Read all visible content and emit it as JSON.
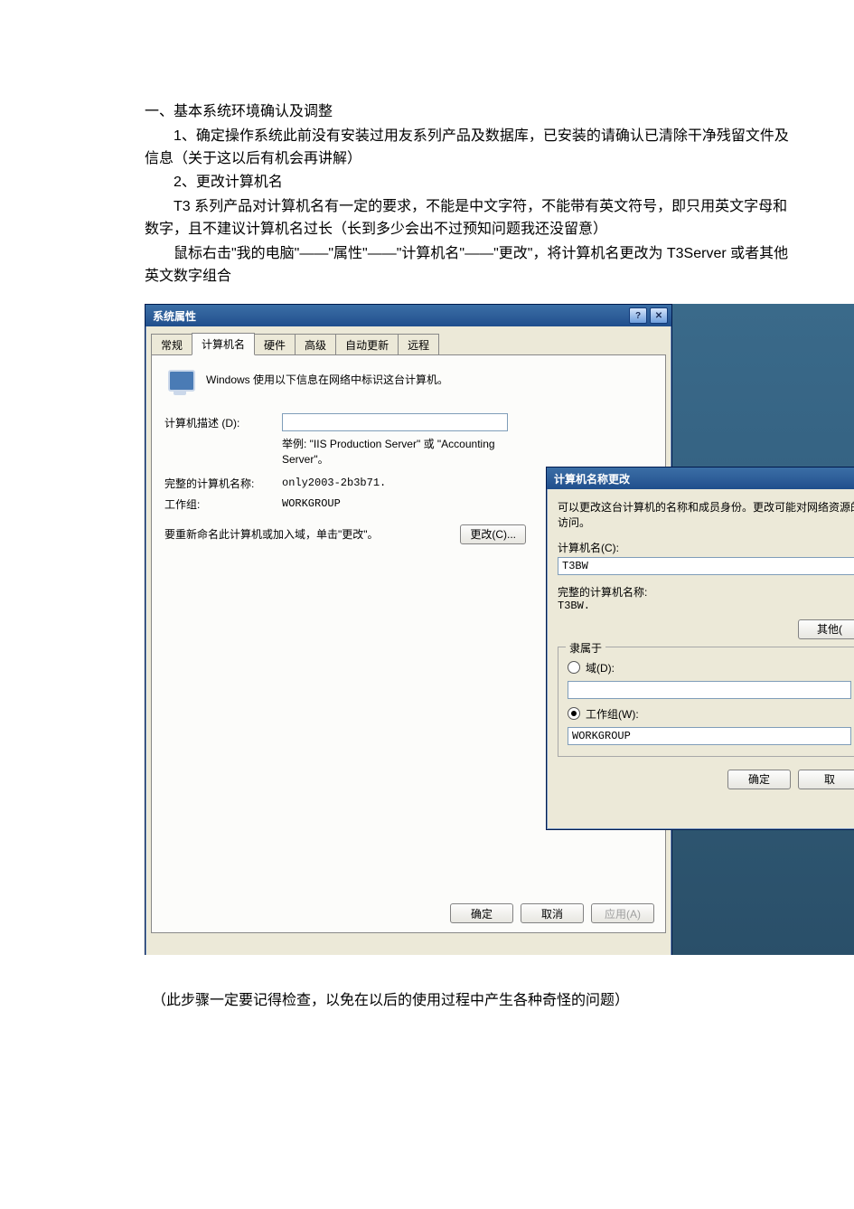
{
  "doc": {
    "h1": "一、基本系统环境确认及调整",
    "p1": "1、确定操作系统此前没有安装过用友系列产品及数据库，已安装的请确认已清除干净残留文件及信息（关于这以后有机会再讲解）",
    "p2": "2、更改计算机名",
    "p3": "T3 系列产品对计算机名有一定的要求，不能是中文字符，不能带有英文符号，即只用英文字母和数字，且不建议计算机名过长（长到多少会出不过预知问题我还没留意）",
    "p4": "鼠标右击\"我的电脑\"——\"属性\"——\"计算机名\"——\"更改\"，将计算机名更改为 T3Server 或者其他英文数字组合",
    "footnote": "（此步骤一定要记得检查，以免在以后的使用过程中产生各种奇怪的问题）"
  },
  "dlg1": {
    "title": "系统属性",
    "help_btn": "?",
    "close_btn": "✕",
    "tabs": {
      "general": "常规",
      "computer_name": "计算机名",
      "hardware": "硬件",
      "advanced": "高级",
      "auto_update": "自动更新",
      "remote": "远程"
    },
    "panel": {
      "info": "Windows 使用以下信息在网络中标识这台计算机。",
      "desc_label": "计算机描述 (D):",
      "desc_hint": "举例: \"IIS Production Server\" 或 \"Accounting Server\"。",
      "fullname_label": "完整的计算机名称:",
      "fullname_value": "only2003-2b3b71.",
      "workgroup_label": "工作组:",
      "workgroup_value": "WORKGROUP",
      "rename_text": "要重新命名此计算机或加入域，单击\"更改\"。",
      "change_btn": "更改(C)..."
    },
    "buttons": {
      "ok": "确定",
      "cancel": "取消",
      "apply": "应用(A)"
    }
  },
  "dlg2": {
    "title": "计算机名称更改",
    "desc": "可以更改这台计算机的名称和成员身份。更改可能对网络资源的访问。",
    "name_label": "计算机名(C):",
    "name_value": "T3BW",
    "fullname_label": "完整的计算机名称:",
    "fullname_value": "T3BW.",
    "other_btn": "其他(",
    "member_legend": "隶属于",
    "domain_label": "域(D):",
    "workgroup_label": "工作组(W):",
    "workgroup_value": "WORKGROUP",
    "ok": "确定",
    "cancel": "取"
  }
}
